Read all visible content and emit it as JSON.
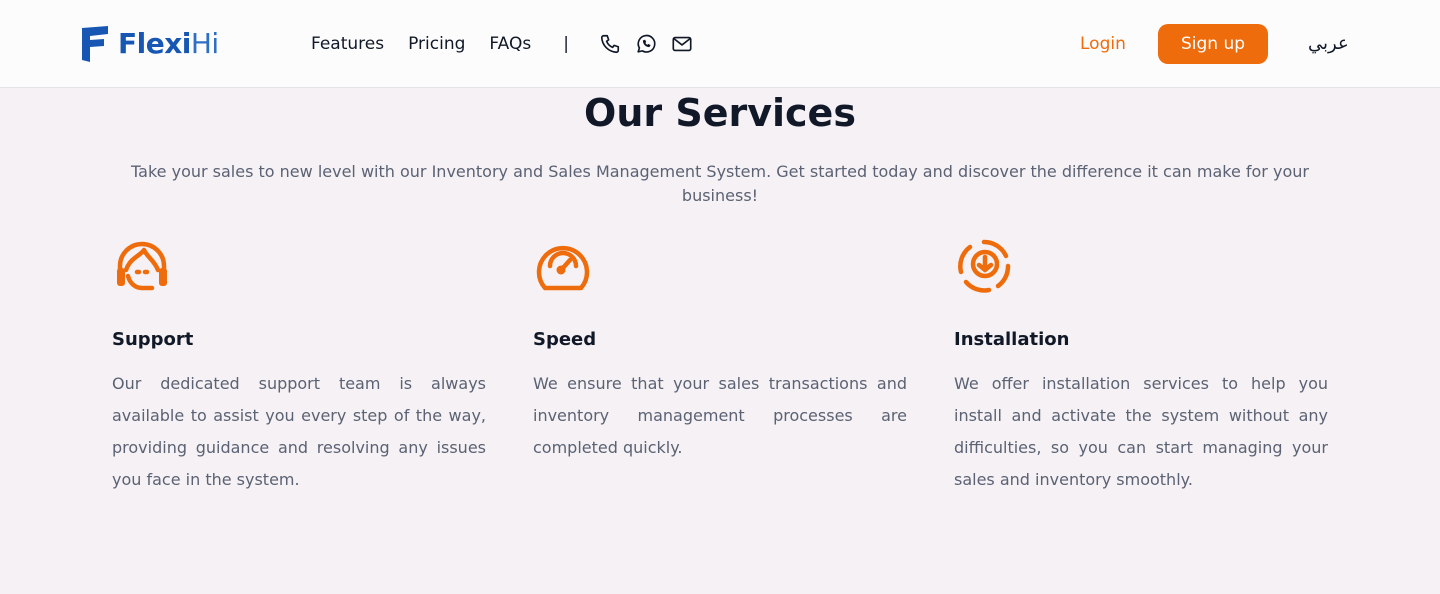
{
  "brand": {
    "name_bold": "Flexi",
    "name_light": "Hi",
    "color": "#1757b3"
  },
  "nav": {
    "links": [
      "Features",
      "Pricing",
      "FAQs"
    ],
    "separator": "|",
    "contact_icons": [
      "phone-icon",
      "whatsapp-icon",
      "mail-icon"
    ],
    "login_label": "Login",
    "signup_label": "Sign up",
    "language_label": "عربي"
  },
  "colors": {
    "accent": "#ee6c0c",
    "text": "#111827",
    "muted": "#5b6273",
    "background": "#f5f1f5"
  },
  "services": {
    "title": "Our Services",
    "subtitle": "Take your sales to new level with our Inventory and Sales Management System. Get started today and discover the difference it can make for your business!",
    "items": [
      {
        "icon": "support-agent-icon",
        "title": "Support",
        "description": "Our dedicated support team is always available to assist you every step of the way, providing guidance and resolving any issues you face in the system."
      },
      {
        "icon": "speedometer-icon",
        "title": "Speed",
        "description": "We ensure that your sales transactions and inventory management processes are completed quickly."
      },
      {
        "icon": "download-installation-icon",
        "title": "Installation",
        "description": "We offer installation services to help you install and activate the system without any difficulties, so you can start managing your sales and inventory smoothly."
      }
    ]
  }
}
